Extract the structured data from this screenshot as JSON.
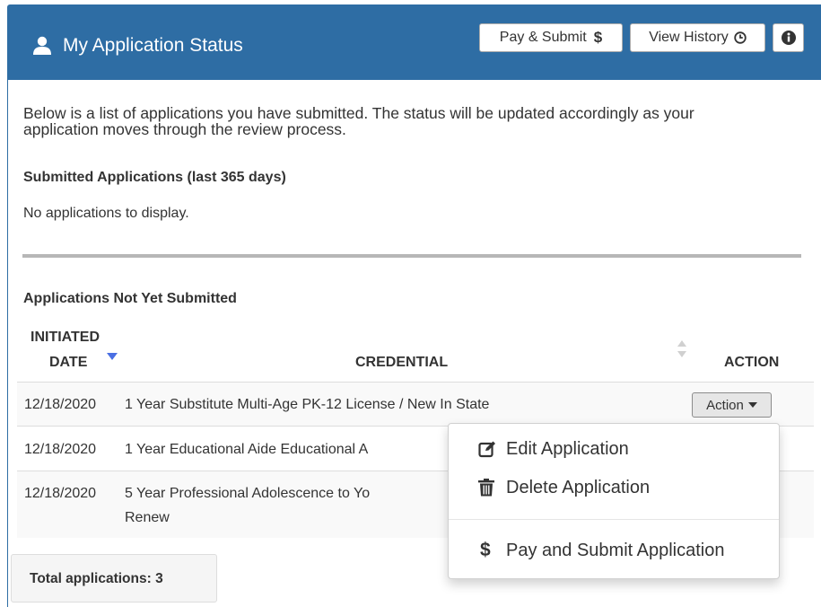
{
  "header": {
    "title": "My Application Status",
    "pay_submit_label": "Pay & Submit",
    "view_history_label": "View History"
  },
  "intro_text": "Below is a list of applications you have submitted. The status will be updated accordingly as your application moves through the review process.",
  "submitted": {
    "title": "Submitted Applications (last 365 days)",
    "empty_text": "No applications to display."
  },
  "unsubmitted": {
    "title": "Applications Not Yet Submitted",
    "columns": {
      "initiated_line1": "INITIATED",
      "initiated_line2": "DATE",
      "credential": "CREDENTIAL",
      "action": "ACTION"
    },
    "rows": [
      {
        "date": "12/18/2020",
        "credential": "1 Year Substitute Multi-Age PK-12 License / New In State"
      },
      {
        "date": "12/18/2020",
        "credential": "1 Year Educational Aide Educational A"
      },
      {
        "date": "12/18/2020",
        "credential_line1": "5 Year Professional Adolescence to Yo",
        "credential_line2": "Renew"
      }
    ],
    "action_button_label": "Action"
  },
  "action_menu": {
    "edit_label": "Edit Application",
    "delete_label": "Delete Application",
    "pay_label": "Pay and Submit Application"
  },
  "footer": {
    "total_label": "Total applications: 3"
  },
  "colors": {
    "header_bg": "#2e6da4",
    "sort_active": "#4a6fe3"
  }
}
